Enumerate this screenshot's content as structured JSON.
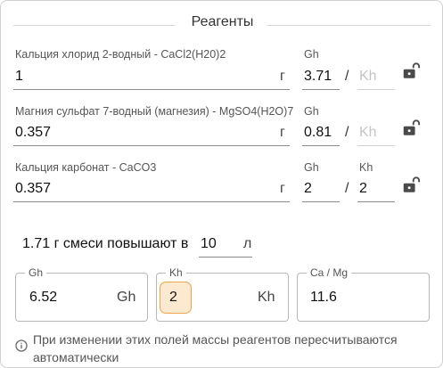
{
  "section": {
    "title": "Реагенты"
  },
  "reagents": [
    {
      "name": "Кальция хлорид 2-водный - CaCl2(H20)2",
      "amount": "1",
      "unit": "г",
      "gh_label": "Gh",
      "gh_value": "3.71",
      "kh_label": "",
      "kh_value": "",
      "kh_placeholder": "Kh",
      "lock": "unlocked"
    },
    {
      "name": "Магния сульфат 7-водный (магнезия) - MgSO4(H2O)7",
      "amount": "0.357",
      "unit": "г",
      "gh_label": "Gh",
      "gh_value": "0.81",
      "kh_label": "",
      "kh_value": "",
      "kh_placeholder": "Kh",
      "lock": "unlocked"
    },
    {
      "name": "Кальция карбонат - CaCO3",
      "amount": "0.357",
      "unit": "г",
      "gh_label": "Gh",
      "gh_value": "2",
      "kh_label": "Kh",
      "kh_value": "2",
      "kh_placeholder": "",
      "lock": "unlocked"
    }
  ],
  "separator": "/",
  "mix": {
    "prefix": "1.71 г смеси повышают в",
    "volume": "10",
    "volume_unit": "л"
  },
  "results": {
    "gh": {
      "label": "Gh",
      "value": "6.52",
      "unit": "Gh"
    },
    "kh": {
      "label": "Kh",
      "value": "2",
      "unit": "Kh"
    },
    "ca_mg": {
      "label": "Ca / Mg",
      "value": "11.6"
    }
  },
  "info": {
    "text": "При изменении этих полей массы реагентов пересчитываются автоматически"
  },
  "colors": {
    "highlight_bg": "#fde9d0",
    "highlight_border": "#e8a64c",
    "lock_icon": "#4a4a4a"
  },
  "icons": {
    "lock": "lock-open-icon",
    "info": "info-icon"
  }
}
